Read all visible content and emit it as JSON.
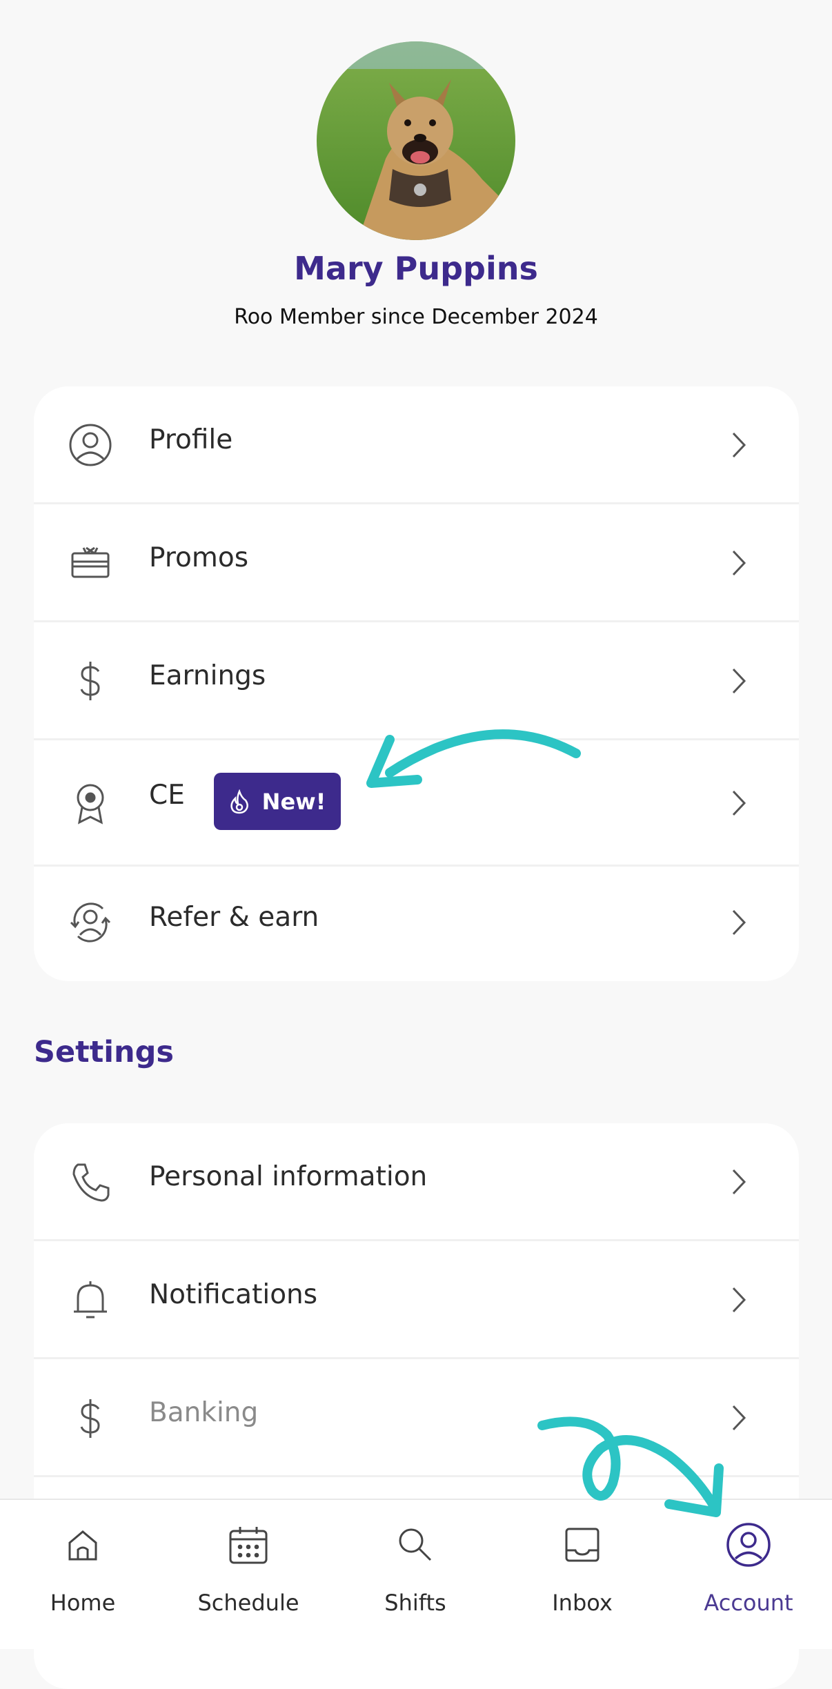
{
  "user": {
    "name": "Mary Puppins",
    "member_since": "Roo Member since December 2024"
  },
  "menu": {
    "items": [
      {
        "label": "Profile",
        "icon": "user-circle-icon"
      },
      {
        "label": "Promos",
        "icon": "gift-card-icon"
      },
      {
        "label": "Earnings",
        "icon": "dollar-icon"
      },
      {
        "label": "CE",
        "icon": "award-ribbon-icon",
        "badge": "New!",
        "badge_icon": "flame-icon"
      },
      {
        "label": "Refer & earn",
        "icon": "refer-user-icon"
      }
    ]
  },
  "settings": {
    "title": "Settings",
    "items": [
      {
        "label": "Personal information",
        "icon": "phone-icon"
      },
      {
        "label": "Notifications",
        "icon": "bell-icon"
      },
      {
        "label": "Banking",
        "icon": "dollar-icon",
        "muted": true
      }
    ]
  },
  "tabbar": {
    "tabs": [
      {
        "label": "Home",
        "icon": "home-icon"
      },
      {
        "label": "Schedule",
        "icon": "calendar-icon"
      },
      {
        "label": "Shifts",
        "icon": "search-icon"
      },
      {
        "label": "Inbox",
        "icon": "inbox-icon"
      },
      {
        "label": "Account",
        "icon": "account-circle-icon",
        "active": true
      }
    ]
  },
  "colors": {
    "brand_purple": "#3d2a8c",
    "accent_teal": "#2cc4c4",
    "background": "#f8f8f8",
    "card": "#ffffff"
  }
}
